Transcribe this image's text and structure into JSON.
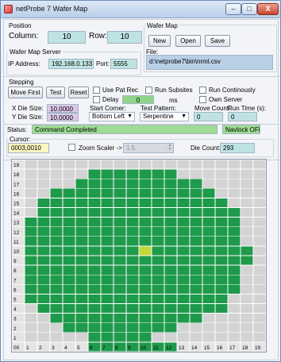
{
  "window": {
    "title": "netProbe 7 Wafer Map",
    "min_glyph": "–",
    "max_glyph": "□",
    "close_glyph": "X",
    "app_icon": "app-icon"
  },
  "position": {
    "group_label": "Position",
    "column_label": "Column:",
    "column_value": "10",
    "row_label": "Row:",
    "row_value": "10"
  },
  "wafer_map_file": {
    "group_label": "Wafer Map",
    "new_label": "New",
    "open_label": "Open",
    "save_label": "Save",
    "file_label": "File:",
    "file_value": "d:\\netprobe7\\bin\\nrml.csv"
  },
  "server": {
    "group_label": "Wafer Map Server",
    "ip_label": "IP Address:",
    "ip_value": "192.168.0.133",
    "port_label": "Port:",
    "port_value": "5555"
  },
  "stepping": {
    "group_label": "Stepping",
    "move_first_label": "Move First",
    "test_label": "Test",
    "reset_label": "Reset",
    "use_pat_rec_label": "Use Pat Rec",
    "run_subsites_label": "Run Subsites",
    "run_continously_label": "Run Continously",
    "delay_label": "Delay",
    "delay_value": "0",
    "delay_unit": "ms",
    "own_server_label": "Own Server",
    "x_die_label": "X Die Size:",
    "x_die_value": "10.0000",
    "y_die_label": "Y Die Size:",
    "y_die_value": "10.0000",
    "start_corner_label": "Start Corner:",
    "start_corner_value": "Bottom Left",
    "test_pattern_label": "Test Pattern:",
    "test_pattern_value": "Serpentine",
    "move_count_label": "Move Count:",
    "move_count_value": "0",
    "run_time_label": "Run Time (s):",
    "run_time_value": "0"
  },
  "status": {
    "label": "Status:",
    "value": "Command Completed",
    "navlock": "Navlock OFF"
  },
  "cursor": {
    "group_label": "Cursor:",
    "value": "0003,0010",
    "zoom_label": "Zoom Scaler ->",
    "zoom_value": "1.5",
    "die_count_label": "Die Count:",
    "die_count_value": "293"
  },
  "map": {
    "cols": 20,
    "rows": 20,
    "col_labels": [
      "00",
      "1",
      "2",
      "3",
      "4",
      "5",
      "6",
      "7",
      "8",
      "9",
      "10",
      "11",
      "12",
      "13",
      "14",
      "15",
      "16",
      "17",
      "18",
      "19"
    ],
    "row_labels": [
      "19",
      "18",
      "17",
      "16",
      "15",
      "14",
      "13",
      "12",
      "11",
      "10",
      "9",
      "8",
      "7",
      "6",
      "5",
      "4",
      "3",
      "2",
      "1"
    ],
    "colors": {
      "die": "#1e9a4b",
      "empty": "#d3d3d3",
      "selected": "#c4d63a",
      "grid_line": "#ffffff",
      "header_bg": "#e4e4e4",
      "header_highlight": "#1e9a4b"
    },
    "highlighted_cols": [
      "6",
      "7",
      "8",
      "9",
      "10",
      "11",
      "12"
    ],
    "selected_die": {
      "col": 10,
      "row": 10
    },
    "die_rows": [
      {
        "row": 18,
        "from": 6,
        "to": 12
      },
      {
        "row": 17,
        "from": 5,
        "to": 14
      },
      {
        "row": 16,
        "from": 3,
        "to": 15
      },
      {
        "row": 15,
        "from": 2,
        "to": 16
      },
      {
        "row": 14,
        "from": 2,
        "to": 17
      },
      {
        "row": 13,
        "from": 1,
        "to": 17
      },
      {
        "row": 12,
        "from": 1,
        "to": 17
      },
      {
        "row": 11,
        "from": 1,
        "to": 17
      },
      {
        "row": 10,
        "from": 1,
        "to": 18
      },
      {
        "row": 9,
        "from": 1,
        "to": 18
      },
      {
        "row": 8,
        "from": 1,
        "to": 17
      },
      {
        "row": 7,
        "from": 1,
        "to": 17
      },
      {
        "row": 6,
        "from": 1,
        "to": 17
      },
      {
        "row": 5,
        "from": 1,
        "to": 16
      },
      {
        "row": 4,
        "from": 2,
        "to": 16
      },
      {
        "row": 3,
        "from": 3,
        "to": 14
      },
      {
        "row": 2,
        "from": 4,
        "to": 12
      },
      {
        "row": 1,
        "from": 6,
        "to": 10
      }
    ]
  }
}
